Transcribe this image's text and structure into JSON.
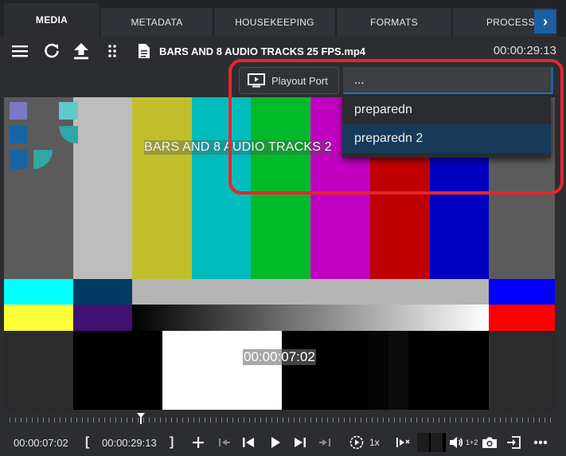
{
  "tabs": {
    "media": "MEDIA",
    "metadata": "METADATA",
    "housekeeping": "HOUSEKEEPING",
    "formats": "FORMATS",
    "processes": "PROCESSES",
    "scroll_label": "›"
  },
  "toolbar": {
    "filename": "BARS AND 8 AUDIO TRACKS 25 FPS.mp4",
    "duration": "00:00:29:13"
  },
  "playout": {
    "button_label": "Playout Port",
    "select_value": "...",
    "options": [
      "preparedn",
      "preparedn 2"
    ],
    "highlighted_option": "preparedn 2"
  },
  "video": {
    "overlay_title": "BARS AND 8 AUDIO TRACKS 2",
    "overlay_timecode": "00:00:07:02"
  },
  "controls": {
    "current_time": "00:00:07:02",
    "mark_in_bracket": "[",
    "out_time": "00:00:29:13",
    "mark_out_bracket": "]",
    "speed": "1x",
    "audio_channels": "1+2"
  },
  "colors": {
    "accent": "#1b5fa3",
    "highlight_border": "#e5262b",
    "selected_option": "#163a57"
  }
}
